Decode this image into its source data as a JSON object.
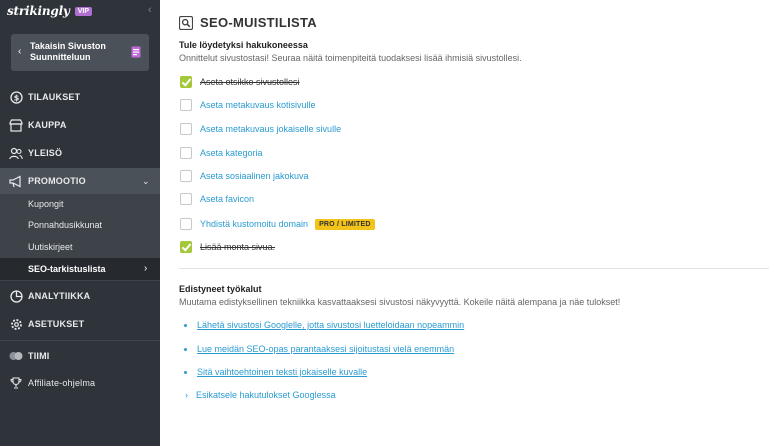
{
  "brand": {
    "name": "strikingly",
    "badge": "VIP"
  },
  "sidebar": {
    "back_label": "Takaisin Sivuston Suunnitteluun",
    "items": [
      {
        "label": "TILAUKSET",
        "icon": "dollar-icon"
      },
      {
        "label": "KAUPPA",
        "icon": "store-icon"
      },
      {
        "label": "YLEISÖ",
        "icon": "audience-icon"
      },
      {
        "label": "PROMOOTIO",
        "icon": "megaphone-icon"
      },
      {
        "label": "ANALYTIIKKA",
        "icon": "analytics-icon"
      },
      {
        "label": "ASETUKSET",
        "icon": "gear-icon"
      },
      {
        "label": "TIIMI",
        "icon": "team-icon"
      },
      {
        "label": "Affiliate-ohjelma",
        "icon": "trophy-icon"
      }
    ],
    "promo_sub": [
      "Kupongit",
      "Ponnahdusikkunat",
      "Uutiskirjeet",
      "SEO-tarkistuslista"
    ]
  },
  "main": {
    "title": "SEO-MUISTILISTA",
    "section1": {
      "heading": "Tule löydetyksi hakukoneessa",
      "subtitle": "Onnittelut sivustostasi! Seuraa näitä toimenpiteitä tuodaksesi lisää ihmisiä sivustollesi."
    },
    "checklist": [
      {
        "label": "Aseta otsikko sivustollesi",
        "done": true
      },
      {
        "label": "Aseta metakuvaus kotisivulle",
        "done": false
      },
      {
        "label": "Aseta metakuvaus jokaiselle sivulle",
        "done": false
      },
      {
        "label": "Aseta kategoria",
        "done": false
      },
      {
        "label": "Aseta sosiaalinen jakokuva",
        "done": false
      },
      {
        "label": "Aseta favicon",
        "done": false
      },
      {
        "label": "Yhdistä kustomoitu domain",
        "done": false,
        "badge": "PRO / LIMITED"
      },
      {
        "label": "Lisää monta sivua.",
        "done": true
      }
    ],
    "section2": {
      "heading": "Edistyneet työkalut",
      "subtitle": "Muutama edistyksellinen tekniikka kasvattaaksesi sivustosi näkyvyyttä. Kokeile näitä alempana ja näe tulokset!",
      "links": [
        "Lähetä sivustosi Googlelle, jotta sivustosi luetteloidaan nopeammin",
        "Lue meidän SEO-opas parantaaksesi sijoitustasi vielä enemmän",
        "Sitä vaihtoehtoinen teksti jokaiselle kuvalle"
      ],
      "preview_link": "Esikatsele hakutulokset Googlessa"
    }
  },
  "colors": {
    "sidebar_bg": "#2f343a",
    "accent_link": "#2a9bd1",
    "check_done": "#a5c73a",
    "pro_badge": "#f2c318",
    "vip_badge": "#b16fd4"
  }
}
